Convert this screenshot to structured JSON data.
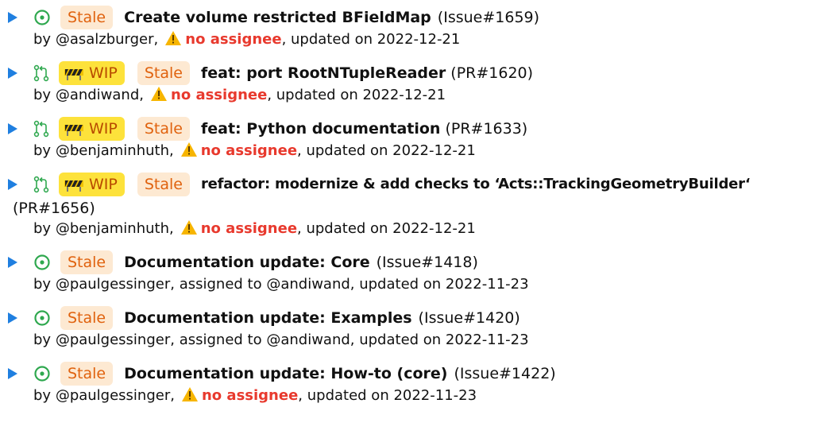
{
  "colors": {
    "accent_triangle": "#1f7fe0",
    "issue_green": "#2fa84f",
    "stale_bg": "#fde9d2",
    "stale_text": "#e0620e",
    "wip_bg": "#fde23b",
    "wip_text": "#b84a00",
    "warning_red": "#e8392d"
  },
  "items": [
    {
      "type": "issue",
      "icon": "issue-open-icon",
      "stale_label": "Stale",
      "title": "Create volume restricted BFieldMap",
      "ref": "(Issue#1659)",
      "by_prefix": "by ",
      "author": "@asalzburger",
      "assignee_text": "no assignee",
      "updated_text": ", updated on 2022-12-21"
    },
    {
      "type": "pr",
      "icon": "pull-request-icon",
      "wip_label": "WIP",
      "stale_label": "Stale",
      "title": "feat: port RootNTupleReader",
      "ref": "(PR#1620)",
      "by_prefix": "by ",
      "author": "@andiwand",
      "assignee_text": "no assignee",
      "updated_text": ", updated on 2022-12-21"
    },
    {
      "type": "pr",
      "icon": "pull-request-icon",
      "wip_label": "WIP",
      "stale_label": "Stale",
      "title": "feat: Python documentation",
      "ref": "(PR#1633)",
      "by_prefix": "by ",
      "author": "@benjaminhuth",
      "assignee_text": "no assignee",
      "updated_text": ", updated on 2022-12-21"
    },
    {
      "type": "pr",
      "icon": "pull-request-icon",
      "wip_label": "WIP",
      "stale_label": "Stale",
      "title": "refactor: modernize & add checks to ‘Acts::TrackingGeometryBuilder‘",
      "ref": "(PR#1656)",
      "by_prefix": "by ",
      "author": "@benjaminhuth",
      "assignee_text": "no assignee",
      "updated_text": ", updated on 2022-12-21"
    },
    {
      "type": "issue",
      "icon": "issue-open-icon",
      "stale_label": "Stale",
      "title": "Documentation update: Core",
      "ref": "(Issue#1418)",
      "by_prefix": "by ",
      "author": "@paulgessinger",
      "assigned_text": ", assigned to @andiwand",
      "updated_text": ", updated on 2022-11-23"
    },
    {
      "type": "issue",
      "icon": "issue-open-icon",
      "stale_label": "Stale",
      "title": "Documentation update: Examples",
      "ref": "(Issue#1420)",
      "by_prefix": "by ",
      "author": "@paulgessinger",
      "assigned_text": ", assigned to @andiwand",
      "updated_text": ", updated on 2022-11-23"
    },
    {
      "type": "issue",
      "icon": "issue-open-icon",
      "stale_label": "Stale",
      "title": "Documentation update: How-to (core)",
      "ref": "(Issue#1422)",
      "by_prefix": "by ",
      "author": "@paulgessinger",
      "assignee_text": "no assignee",
      "updated_text": ", updated on 2022-11-23"
    }
  ]
}
